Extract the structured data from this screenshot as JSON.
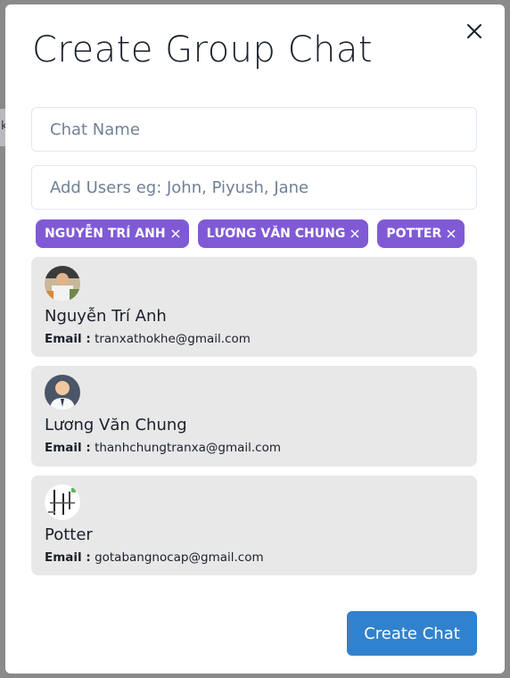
{
  "modal": {
    "title": "Create Group Chat",
    "close_icon": "close-icon"
  },
  "form": {
    "chat_name_placeholder": "Chat Name",
    "chat_name_value": "",
    "add_users_placeholder": "Add Users eg: John, Piyush, Jane",
    "add_users_value": ""
  },
  "selected_users": [
    {
      "label": "NGUYỄN TRÍ ANH",
      "remove_icon": "close-icon"
    },
    {
      "label": "LƯƠNG VĂN CHUNG",
      "remove_icon": "close-icon"
    },
    {
      "label": "POTTER",
      "remove_icon": "close-icon"
    }
  ],
  "search_results": [
    {
      "name": "Nguyễn Trí Anh",
      "email_label": "Email :",
      "email": "tranxathokhe@gmail.com",
      "avatar": "photo-avatar"
    },
    {
      "name": "Lương Văn Chung",
      "email_label": "Email :",
      "email": "thanhchungtranxa@gmail.com",
      "avatar": "default-user-avatar"
    },
    {
      "name": "Potter",
      "email_label": "Email :",
      "email": "gotabangnocap@gmail.com",
      "avatar": "photo-avatar"
    }
  ],
  "actions": {
    "create_label": "Create Chat"
  },
  "backdrop": {
    "edge_text": "k"
  },
  "colors": {
    "chip_bg": "#805ad5",
    "card_bg": "#e8e8e8",
    "primary_button": "#3182ce",
    "overlay": "#8a8a8a"
  }
}
